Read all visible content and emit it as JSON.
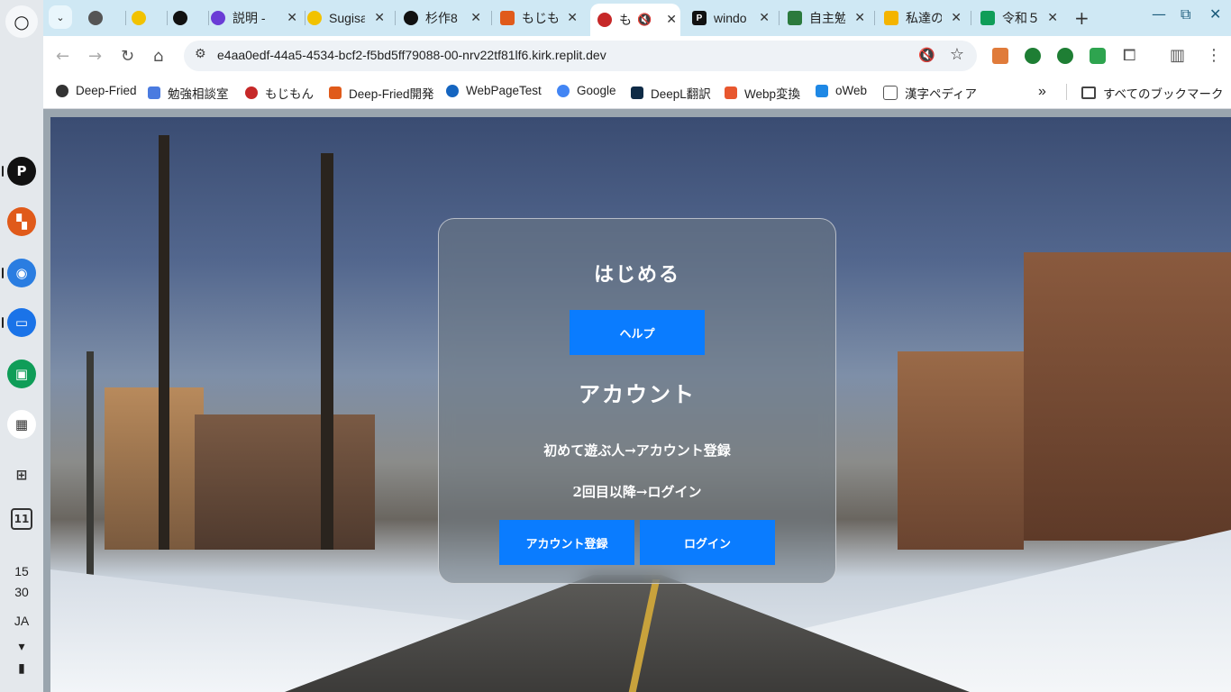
{
  "shelf": {
    "launcher_icon": "○",
    "apps": [
      {
        "name": "pixiv",
        "glyph": "P",
        "color": "#111111"
      },
      {
        "name": "deep-fried",
        "glyph": "▚",
        "color": "#e05a1a"
      },
      {
        "name": "chrome",
        "glyph": "◉",
        "color": "#2a7de1"
      },
      {
        "name": "files",
        "glyph": "▭",
        "color": "#1a73e8"
      },
      {
        "name": "classroom",
        "glyph": "▣",
        "color": "#0f9d58"
      },
      {
        "name": "qr",
        "glyph": "▦",
        "color": "#333333"
      },
      {
        "name": "screen-capture",
        "glyph": "⊞",
        "color": "#444444"
      },
      {
        "name": "calendar",
        "glyph": "11",
        "color": "#444444"
      }
    ],
    "time_hour": "15",
    "time_min": "30",
    "ime": "JA"
  },
  "tabs": [
    {
      "label": "",
      "icon": "globe-icon",
      "color": "#555555"
    },
    {
      "label": "",
      "icon": "emoji-icon",
      "color": "#f2c200"
    },
    {
      "label": "",
      "icon": "github-icon",
      "color": "#111111"
    },
    {
      "label": "説明 -",
      "icon": "circle-c-icon",
      "color": "#6a3cd6"
    },
    {
      "label": "Sugisa",
      "icon": "emoji-icon",
      "color": "#f2c200"
    },
    {
      "label": "杉作8",
      "icon": "github-icon",
      "color": "#111111"
    },
    {
      "label": "もじも",
      "icon": "deepfried-icon",
      "color": "#e05a1a"
    },
    {
      "label": "も",
      "icon": "mojimon-icon",
      "color": "#c62828",
      "active": true
    },
    {
      "label": "windo",
      "icon": "p-icon",
      "color": "#111111"
    },
    {
      "label": "自主勉",
      "icon": "grid-icon",
      "color": "#2b7a3d"
    },
    {
      "label": "私達の",
      "icon": "slides-icon",
      "color": "#f4b400"
    },
    {
      "label": "令和５",
      "icon": "sheets-icon",
      "color": "#0f9d58"
    }
  ],
  "toolbar": {
    "url": "e4aa0edf-44a5-4534-bcf2-f5bd5ff79088-00-nrv22tf81lf6.kirk.replit.dev"
  },
  "bookmarks": [
    {
      "label": "Deep-Fried",
      "color": "#333333"
    },
    {
      "label": "勉強相談室",
      "color": "#4a7be0"
    },
    {
      "label": "もじもん",
      "color": "#c62828"
    },
    {
      "label": "Deep-Fried開発",
      "color": "#e05a1a"
    },
    {
      "label": "WebPageTest",
      "color": "#1565c0"
    },
    {
      "label": "Google",
      "color": "#4285f4"
    },
    {
      "label": "DeepL翻訳",
      "color": "#0f2b46"
    },
    {
      "label": "Webp変換",
      "color": "#e8572e"
    },
    {
      "label": "oWeb",
      "color": "#1e88e5"
    },
    {
      "label": "漢字ペディア",
      "color": "#555555"
    }
  ],
  "all_bookmarks": "すべてのブックマーク",
  "dialog": {
    "title_start": "はじめる",
    "help_button": "ヘルプ",
    "title_account": "アカウント",
    "line1": "初めて遊ぶ人→アカウント登録",
    "line2": "2回目以降→ログイン",
    "register_button": "アカウント登録",
    "login_button": "ログイン",
    "accent": "#0a7cff"
  }
}
